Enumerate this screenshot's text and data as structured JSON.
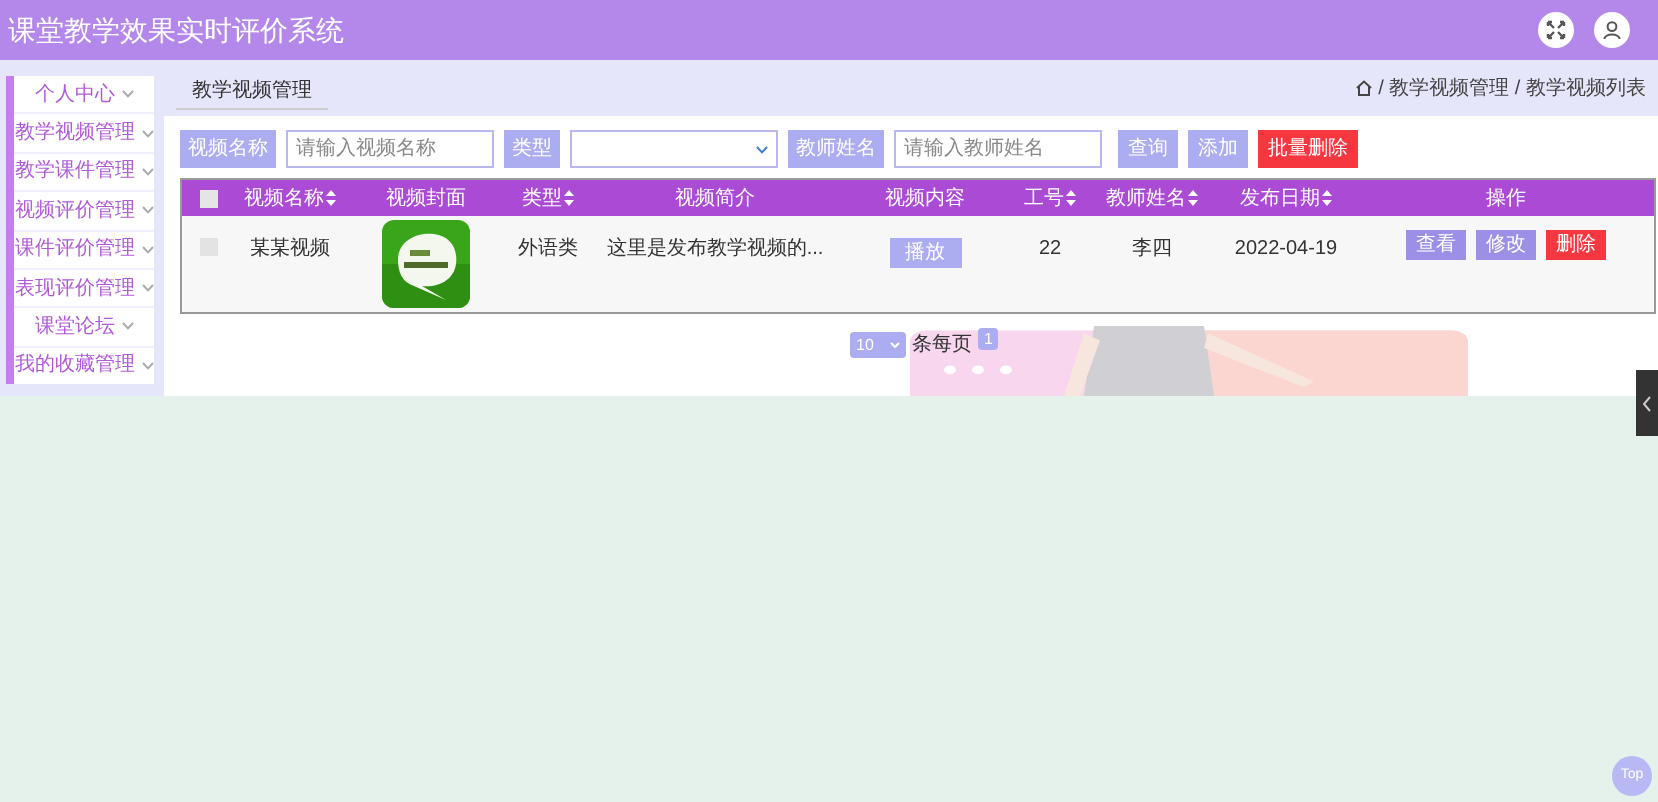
{
  "header": {
    "title": "课堂教学效果实时评价系统"
  },
  "sidebar": {
    "items": [
      {
        "label": "个人中心"
      },
      {
        "label": "教学视频管理"
      },
      {
        "label": "教学课件管理"
      },
      {
        "label": "视频评价管理"
      },
      {
        "label": "课件评价管理"
      },
      {
        "label": "表现评价管理"
      },
      {
        "label": "课堂论坛"
      },
      {
        "label": "我的收藏管理"
      }
    ]
  },
  "tab": {
    "label": "教学视频管理"
  },
  "breadcrumb": {
    "text": "/ 教学视频管理 / 教学视频列表"
  },
  "search": {
    "fields": [
      {
        "label": "视频名称",
        "kind": "input",
        "placeholder": "请输入视频名称"
      },
      {
        "label": "类型",
        "kind": "select"
      },
      {
        "label": "教师姓名",
        "kind": "input",
        "placeholder": "请输入教师姓名"
      }
    ],
    "buttons": [
      {
        "label": "查询",
        "kind": "normal"
      },
      {
        "label": "添加",
        "kind": "normal"
      },
      {
        "label": "批量删除",
        "kind": "danger"
      }
    ]
  },
  "table": {
    "select_all": {
      "checked": false
    },
    "columns": [
      {
        "label": "视频名称",
        "sortable": true
      },
      {
        "label": "视频封面",
        "sortable": false
      },
      {
        "label": "类型",
        "sortable": true
      },
      {
        "label": "视频简介",
        "sortable": false
      },
      {
        "label": "视频内容",
        "sortable": false
      },
      {
        "label": "工号",
        "sortable": true
      },
      {
        "label": "教师姓名",
        "sortable": true
      },
      {
        "label": "发布日期",
        "sortable": true
      },
      {
        "label": "操作",
        "sortable": false
      }
    ],
    "rows": [
      {
        "checked": false,
        "name": "某某视频",
        "type": "外语类",
        "intro": "这里是发布教学视频的...",
        "content_button": "播放",
        "id": "22",
        "teacher": "李四",
        "date": "2022-04-19",
        "actions": [
          {
            "label": "查看",
            "kind": "normal"
          },
          {
            "label": "修改",
            "kind": "normal"
          },
          {
            "label": "删除",
            "kind": "danger"
          }
        ]
      }
    ]
  },
  "pagination": {
    "page_size": "10",
    "per_page_label": "条每页",
    "pages": [
      {
        "label": "1",
        "selected": true
      }
    ]
  },
  "back_to_top": {
    "label": "Top"
  }
}
